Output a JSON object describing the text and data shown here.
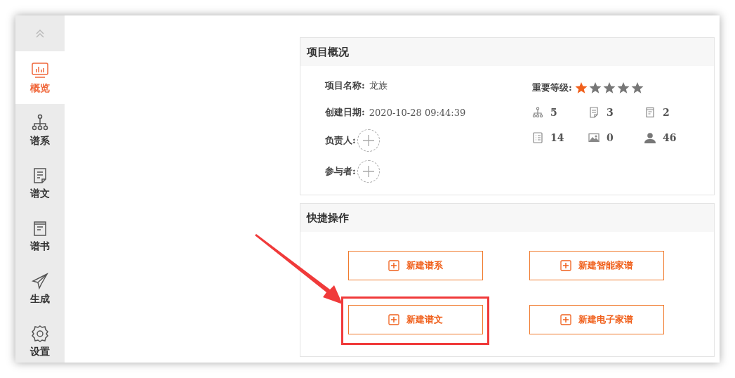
{
  "sidebar": {
    "items": [
      {
        "kind": "monitor",
        "label": "概览",
        "selected": true
      },
      {
        "kind": "tree",
        "label": "谱系",
        "selected": false
      },
      {
        "kind": "document",
        "label": "谱文",
        "selected": false
      },
      {
        "kind": "book",
        "label": "谱书",
        "selected": false
      },
      {
        "kind": "send",
        "label": "生成",
        "selected": false
      },
      {
        "kind": "gear",
        "label": "设置",
        "selected": false
      }
    ]
  },
  "overview": {
    "title": "项目概况",
    "fields": [
      {
        "kind": "text",
        "label": "项目名称:",
        "value": "龙族"
      },
      {
        "kind": "text",
        "label": "创建日期:",
        "value": "2020-10-28 09:44:39"
      },
      {
        "kind": "add",
        "label": "负责人:"
      },
      {
        "kind": "add",
        "label": "参与者:"
      }
    ],
    "importance": {
      "label": "重要等级:",
      "stars": 1
    },
    "stats": [
      {
        "kind": "tree",
        "value": "5"
      },
      {
        "kind": "document",
        "value": "3"
      },
      {
        "kind": "book",
        "value": "2"
      },
      {
        "kind": "list",
        "value": "14"
      },
      {
        "kind": "image",
        "value": "0"
      },
      {
        "kind": "person",
        "value": "46"
      }
    ]
  },
  "quick_actions": {
    "title": "快捷操作",
    "buttons": [
      {
        "label": "新建谱系",
        "highlighted": false
      },
      {
        "label": "新建智能家谱",
        "highlighted": false
      },
      {
        "label": "新建谱文",
        "highlighted": true
      },
      {
        "label": "新建电子家谱",
        "highlighted": false
      }
    ]
  }
}
